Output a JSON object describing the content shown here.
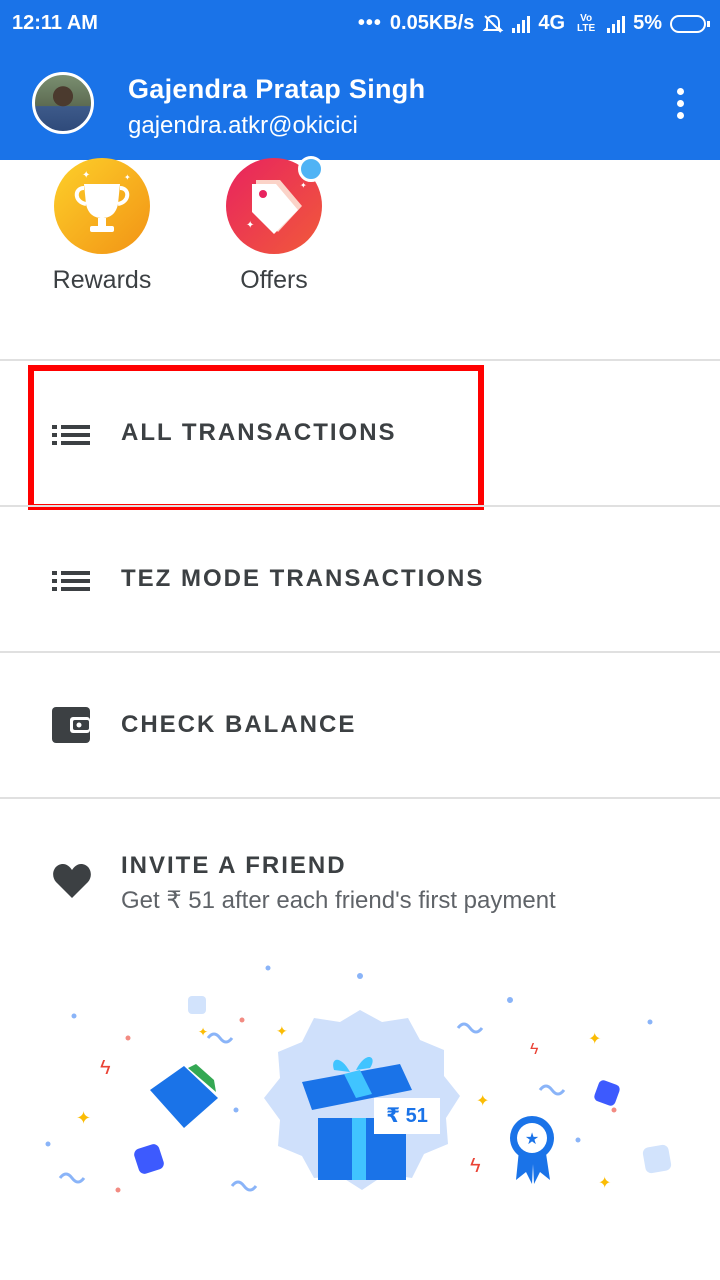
{
  "status_bar": {
    "time": "12:11 AM",
    "speed": "0.05KB/s",
    "network": "4G",
    "volte": "Vo LTE",
    "battery": "5%"
  },
  "header": {
    "name": "Gajendra Pratap Singh",
    "upi_id": "gajendra.atkr@okicici",
    "menu_icon": "more-vert-icon",
    "bg_color": "#1a73e8"
  },
  "quick_actions": [
    {
      "label": "Rewards",
      "icon": "trophy-icon"
    },
    {
      "label": "Offers",
      "icon": "tag-icon"
    }
  ],
  "menu": [
    {
      "label": "ALL TRANSACTIONS",
      "icon": "list-icon",
      "highlighted": true
    },
    {
      "label": "TEZ MODE TRANSACTIONS",
      "icon": "list-icon"
    },
    {
      "label": "CHECK BALANCE",
      "icon": "wallet-icon"
    }
  ],
  "invite": {
    "title": "INVITE A FRIEND",
    "subtitle": "Get ₹ 51 after each friend's first payment",
    "reward_tag": "₹ 51",
    "icon": "heart-icon"
  },
  "colors": {
    "highlight": "#ff0000",
    "accent": "#1a73e8"
  }
}
